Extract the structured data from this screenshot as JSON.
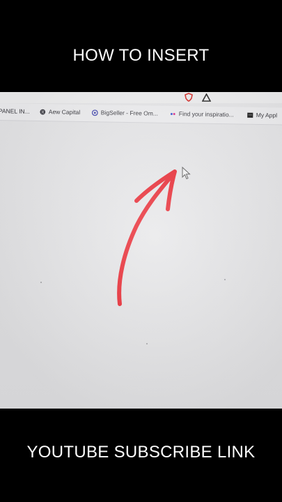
{
  "captions": {
    "top": "HOW TO INSERT",
    "bottom": "YOUTUBE SUBSCRIBE LINK"
  },
  "bookmarks": [
    {
      "label": "PANEL IN...",
      "icon": "panel-icon"
    },
    {
      "label": "Aew Capital",
      "icon": "globe-icon"
    },
    {
      "label": "BigSeller - Free Om...",
      "icon": "bigseller-icon"
    },
    {
      "label": "Find your inspiratio...",
      "icon": "flickr-dots-icon"
    },
    {
      "label": "My Appl",
      "icon": "app-icon"
    }
  ],
  "extensions": [
    {
      "icon": "shield-icon",
      "color": "#d9302c"
    },
    {
      "icon": "warning-triangle-icon",
      "color": "#2a2a2a"
    }
  ],
  "colors": {
    "arrow": "#e8202a",
    "background": "#000000",
    "caption_text": "#ffffff",
    "screen": "#e6e6e8"
  }
}
